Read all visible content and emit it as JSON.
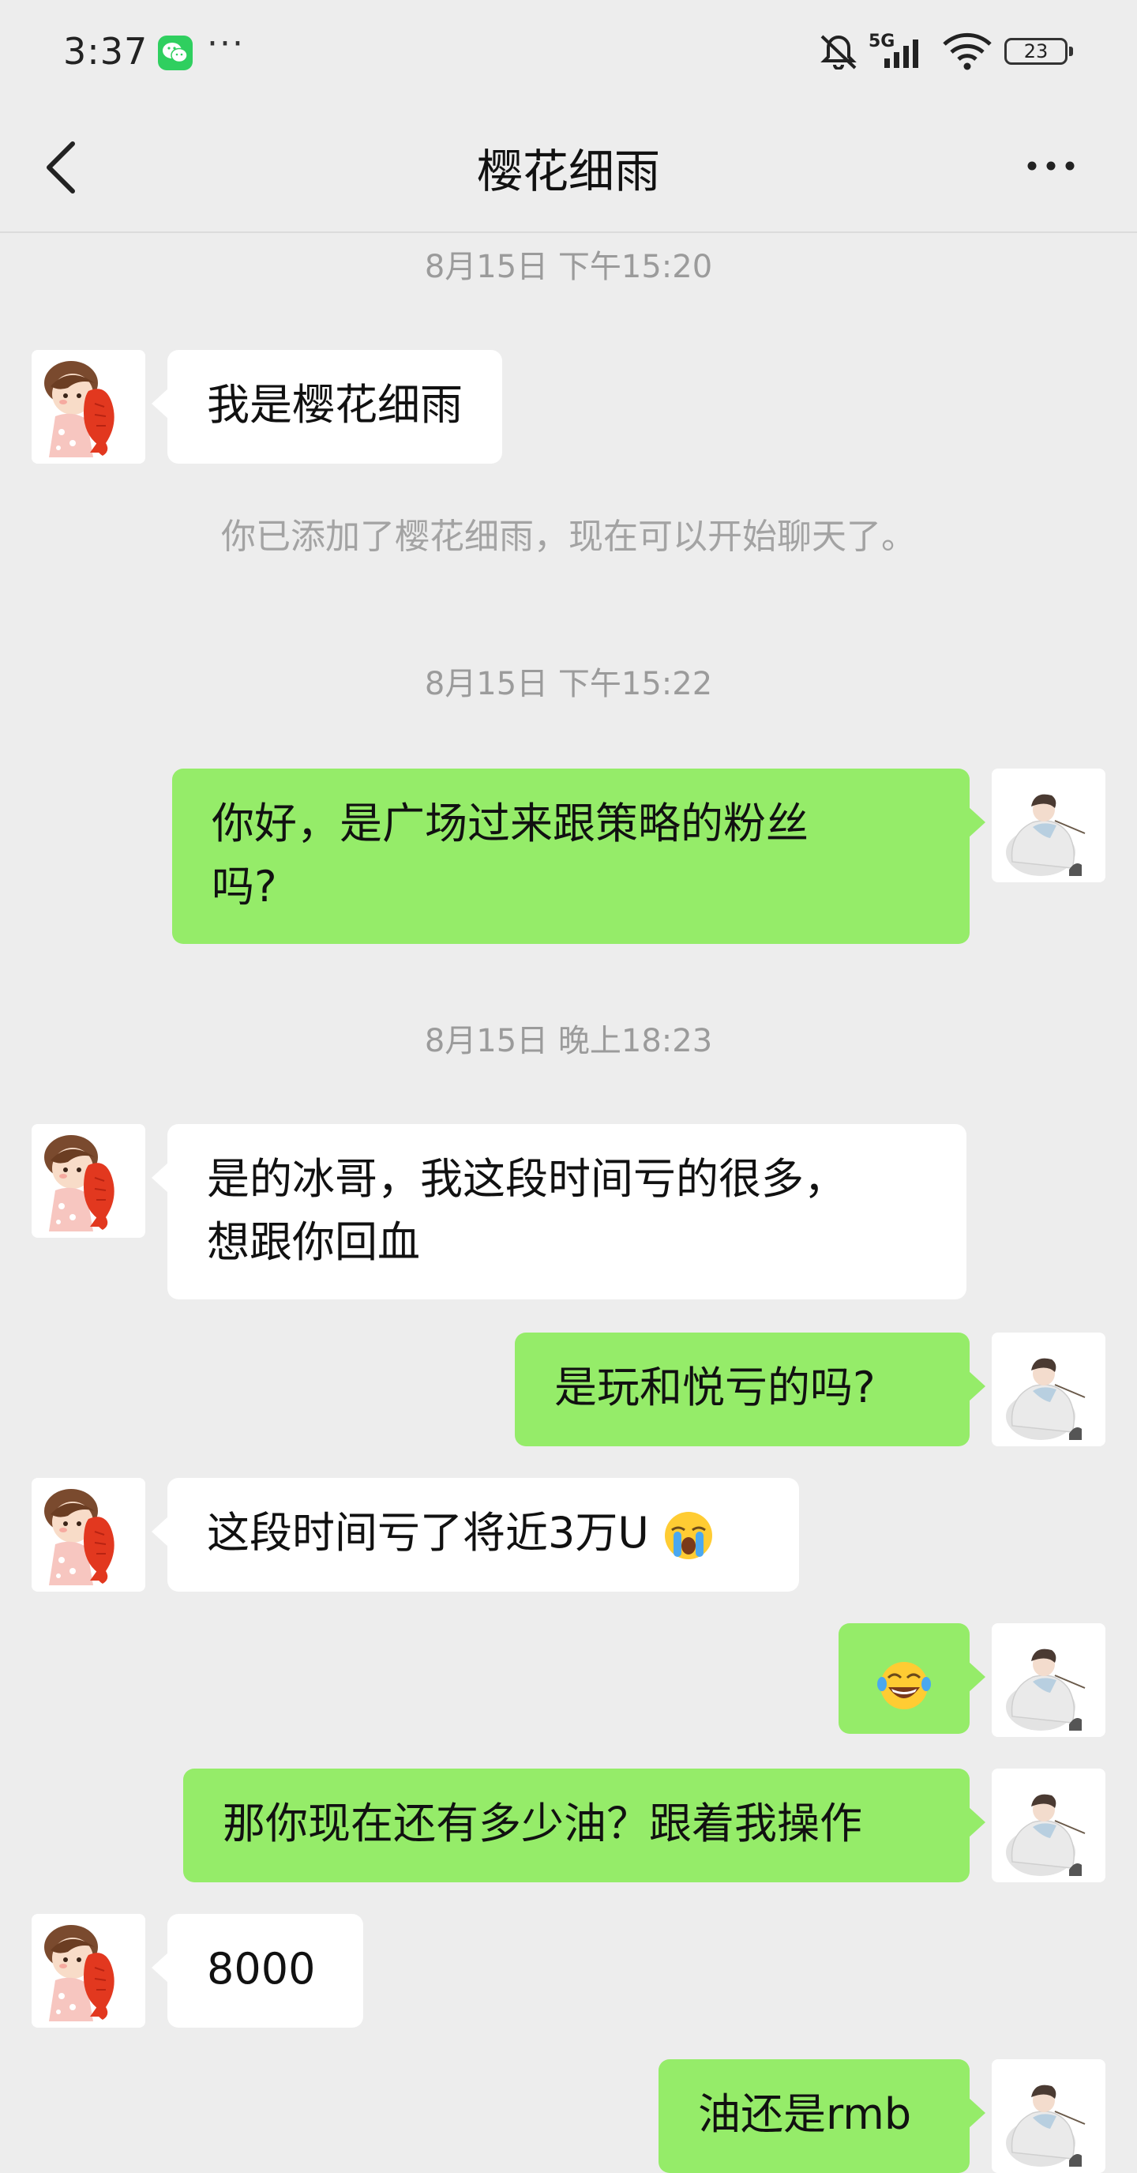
{
  "status_bar": {
    "time": "3:37",
    "network": "5G",
    "battery": "23",
    "icons": [
      "wechat-icon",
      "more-dots-icon",
      "mute-icon",
      "signal-icon",
      "wifi-icon",
      "battery-icon"
    ]
  },
  "header": {
    "title": "樱花细雨",
    "back_icon": "chevron-left-icon",
    "more_icon": "more-dots-icon"
  },
  "colors": {
    "background": "#ededed",
    "bubble_sent": "#95ec69",
    "bubble_received": "#ffffff",
    "timestamp_text": "#9b9b9b"
  },
  "chat": {
    "timestamp_1": "8月15日 下午15:20",
    "msg_1": "我是樱花细雨",
    "system_msg": "你已添加了樱花细雨，现在可以开始聊天了。",
    "timestamp_2": "8月15日 下午15:22",
    "msg_2_line_1": "你好，是广场过来跟策略的粉丝",
    "msg_2_line_2": "吗?",
    "timestamp_3": "8月15日 晚上18:23",
    "msg_3_line_1": "是的冰哥，我这段时间亏的很多，",
    "msg_3_line_2": "想跟你回血",
    "msg_4": "是玩和悦亏的吗?",
    "msg_5": "这段时间亏了将近3万U",
    "msg_5_emoji": "crying-emoji",
    "msg_6_emoji": "tears-of-joy-emoji",
    "msg_7": "那你现在还有多少油？跟着我操作",
    "msg_8": "8000",
    "msg_9": "油还是rmb"
  }
}
